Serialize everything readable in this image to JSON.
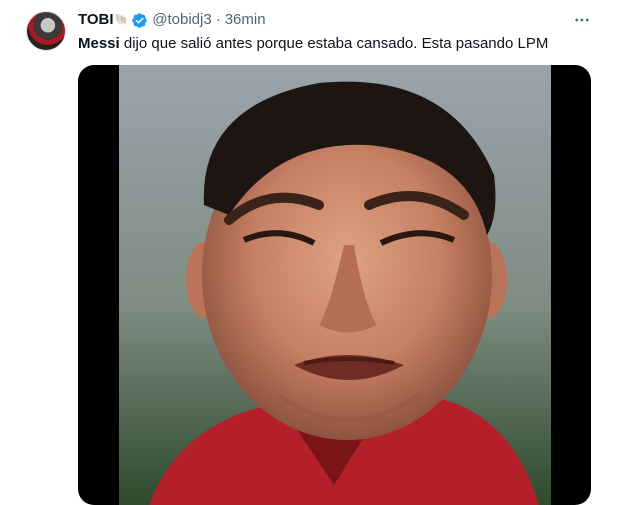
{
  "tweet": {
    "author": {
      "display_name": "TOBI",
      "name_emoji": "🐚",
      "handle": "@tobidj3",
      "separator": "·",
      "time": "36min",
      "verified": true
    },
    "text_bold": "Messi",
    "text_rest": " dijo que salió antes porque estaba cansado. Esta pasando LPM",
    "media": {
      "type": "video",
      "description_icon": "video-frame"
    }
  },
  "icons": {
    "verified": "verified-badge-icon",
    "more": "more-options-icon"
  },
  "colors": {
    "text": "#0f1419",
    "secondary": "#536471",
    "verified": "#1d9bf0",
    "jersey": "#b3202a"
  }
}
